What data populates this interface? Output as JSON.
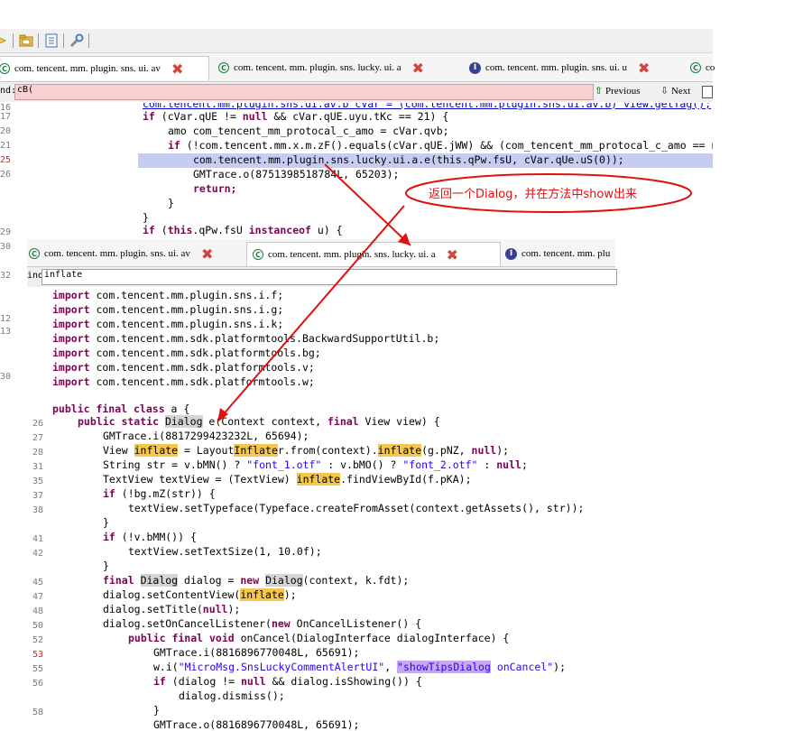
{
  "toolbar": {
    "icons": [
      "arrow-icon",
      "folder-icon",
      "document-icon",
      "wrench-icon"
    ]
  },
  "window1": {
    "tabs": [
      {
        "label": "com. tencent. mm. plugin. sns. ui. av",
        "icon": "class-icon",
        "active": true
      },
      {
        "label": "com. tencent. mm. plugin. sns. lucky. ui. a",
        "icon": "class-icon",
        "active": false
      },
      {
        "label": "com. tencent. mm. plugin. sns. ui. u",
        "icon": "interface-icon",
        "active": false
      },
      {
        "label": "co",
        "icon": "class-icon",
        "active": false
      }
    ],
    "find": {
      "label": "nd:",
      "value": "cB(",
      "prev_label": "Previous",
      "next_label": "Next"
    },
    "line_numbers": [
      {
        "n": "16",
        "hl": false
      },
      {
        "n": "17",
        "hl": false
      },
      {
        "n": "20",
        "hl": false
      },
      {
        "n": "21",
        "hl": false
      },
      {
        "n": "25",
        "hl": true
      },
      {
        "n": "26",
        "hl": false
      },
      {
        "n": "29",
        "hl": false
      },
      {
        "n": "30",
        "hl": false
      },
      {
        "n": "32",
        "hl": false
      },
      {
        "n": "12",
        "hl": false
      },
      {
        "n": "13",
        "hl": false
      },
      {
        "n": "30",
        "hl": false
      }
    ],
    "code": [
      "com.tencent.mm.plugin.sns.ui.av.b cVar = (com.tencent.mm.plugin.sns.ui.av.b) view.getTag();",
      "if (cVar.qUE != null && cVar.qUE.uyu.tKc == 21) {",
      "amo com_tencent_mm_protocal_c_amo = cVar.qvb;",
      "if (!com.tencent.mm.x.m.zF().equals(cVar.qUE.jWW) && (com_tencent_mm_protocal_c_amo == null",
      "com.tencent.mm.plugin.sns.lucky.ui.a.e(this.qPw.fsU, cVar.qUe.uS(0));",
      "GMTrace.o(8751398518784L, 65203);",
      "return;",
      "}",
      "}",
      "if (this.qPw.fsU instanceof u) {"
    ]
  },
  "annotation": {
    "text": "返回一个Dialog，并在方法中show出来"
  },
  "window2": {
    "tabs": [
      {
        "label": "com. tencent. mm. plugin. sns. ui. av",
        "icon": "class-icon",
        "active": false
      },
      {
        "label": "com. tencent. mm. plugin. sns. lucky. ui. a",
        "icon": "class-icon",
        "active": true
      },
      {
        "label": "com. tencent. mm. plu",
        "icon": "interface-icon",
        "active": false
      }
    ],
    "find": {
      "label": "ind:",
      "value": "inflate"
    },
    "code": [
      "import com.tencent.mm.plugin.sns.i.f;",
      "import com.tencent.mm.plugin.sns.i.g;",
      "import com.tencent.mm.plugin.sns.i.k;",
      "import com.tencent.mm.sdk.platformtools.BackwardSupportUtil.b;",
      "import com.tencent.mm.sdk.platformtools.bg;",
      "import com.tencent.mm.sdk.platformtools.v;",
      "import com.tencent.mm.sdk.platformtools.w;",
      "",
      "public final class a {"
    ]
  },
  "window3": {
    "line_numbers": [
      "26",
      "27",
      "28",
      "31",
      "35",
      "37",
      "38",
      "",
      "41",
      "42",
      "",
      "45",
      "47",
      "48",
      "50",
      "52",
      "53",
      "55",
      "56",
      "",
      "58"
    ],
    "code": [
      "public static Dialog e(Context context, final View view) {",
      "GMTrace.i(8817299423232L, 65694);",
      "View inflate = LayoutInflater.from(context).inflate(g.pNZ, null);",
      "String str = v.bMN() ? \"font_1.otf\" : v.bMO() ? \"font_2.otf\" : null;",
      "TextView textView = (TextView) inflate.findViewById(f.pKA);",
      "if (!bg.mZ(str)) {",
      "textView.setTypeface(Typeface.createFromAsset(context.getAssets(), str));",
      "}",
      "if (!v.bMM()) {",
      "textView.setTextSize(1, 10.0f);",
      "}",
      "final Dialog dialog = new Dialog(context, k.fdt);",
      "dialog.setContentView(inflate);",
      "dialog.setTitle(null);",
      "dialog.setOnCancelListener(new OnCancelListener() {",
      "public final void onCancel(DialogInterface dialogInterface) {",
      "GMTrace.i(8816896770048L, 65691);",
      "w.i(\"MicroMsg.SnsLuckyCommentAlertUI\", \"showTipsDialog onCancel\");",
      "if (dialog != null && dialog.isShowing()) {",
      "dialog.dismiss();",
      "}",
      "GMTrace.o(8816896770048L, 65691);"
    ]
  }
}
